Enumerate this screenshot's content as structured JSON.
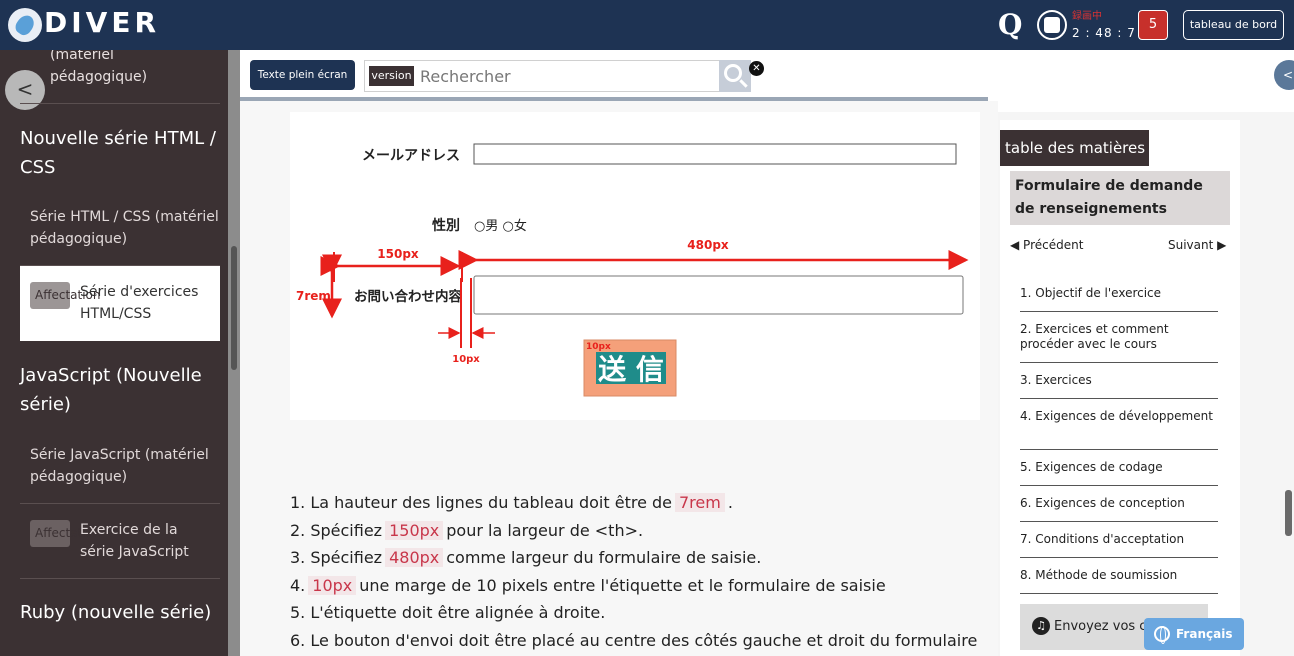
{
  "header": {
    "logo_text": "DIVER",
    "rec_status": "録画中",
    "timer": "2 : 48 : 7",
    "notification_count": "5",
    "dashboard_label": "tableau de bord"
  },
  "sidebar": {
    "top_item": "(matériel pédagogique)",
    "back_label": "<",
    "sections": [
      {
        "title": "Nouvelle série HTML / CSS"
      },
      {
        "title": "JavaScript (Nouvelle série)"
      },
      {
        "title": "Ruby (nouvelle série)"
      }
    ],
    "items": [
      {
        "label": "Série HTML / CSS (matériel pédagogique)"
      },
      {
        "tag": "Affectation",
        "label": "Série d'exercices HTML/CSS"
      },
      {
        "label": "Série JavaScript (matériel pédagogique)"
      },
      {
        "tag": "Affectation",
        "label": "Exercice de la série JavaScript"
      }
    ]
  },
  "toolbar": {
    "fullscreen_label": "Texte plein écran",
    "version_label": "version",
    "search_placeholder": "Rechercher",
    "clear_label": "✕",
    "right_toggle": "<"
  },
  "figure": {
    "email_label": "メールアドレス",
    "gender_label": "性別",
    "gender_options": "○男 ○女",
    "inquiry_label": "お問い合わせ内容",
    "submit_label": "送 信",
    "dim_150": "150px",
    "dim_480": "480px",
    "dim_7rem": "7rem",
    "dim_10px_bottom": "10px",
    "dim_10px_btn": "10px"
  },
  "instructions": [
    {
      "pre": "1. La hauteur des lignes du tableau doit être de",
      "code": "7rem",
      "post": "."
    },
    {
      "pre": "2. Spécifiez",
      "code": "150px",
      "post": "pour la largeur de <th>."
    },
    {
      "pre": "3. Spécifiez",
      "code": "480px",
      "post": "comme largeur du formulaire de saisie."
    },
    {
      "pre": "4.",
      "code": "10px",
      "post": "une marge de 10 pixels entre l'étiquette et le formulaire de saisie"
    },
    {
      "pre": "5. L'étiquette doit être alignée à droite.",
      "code": "",
      "post": ""
    },
    {
      "pre": "6. Le bouton d'envoi doit être placé au centre des côtés gauche et droit du formulaire",
      "code": "",
      "post": ""
    }
  ],
  "toc": {
    "title": "table des matières",
    "heading": "Formulaire de demande de renseignements",
    "prev": "◀  Précédent",
    "next": "Suivant ▶",
    "items": [
      "1. Objectif de l'exercice",
      "2. Exercices et comment procéder avec le cours",
      "3. Exercices",
      "4. Exigences de développement",
      "5. Exigences de codage",
      "6. Exigences de conception",
      "7. Conditions d'acceptation",
      "8. Méthode de soumission"
    ],
    "feedback_label": "Envoyez vos comm",
    "language_label": "Français"
  }
}
